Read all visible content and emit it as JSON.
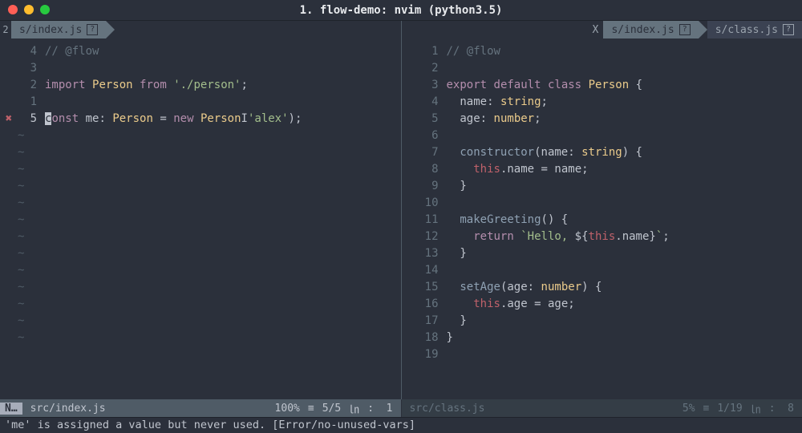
{
  "window": {
    "title": "1. flow-demo: nvim (python3.5)"
  },
  "left": {
    "tab": {
      "prefix": "2",
      "label": "s/index.js",
      "badge": "?"
    },
    "lines": [
      {
        "n": "4",
        "sign": "",
        "html": "<span class='c-comment'>// @flow</span>"
      },
      {
        "n": "3",
        "sign": "",
        "html": ""
      },
      {
        "n": "2",
        "sign": "",
        "html": "<span class='c-kw'>import</span> <span class='c-type'>Person</span> <span class='c-kw'>from</span> <span class='c-str'>'./person'</span><span class='c-punc'>;</span>"
      },
      {
        "n": "1",
        "sign": "",
        "html": ""
      },
      {
        "n": "5",
        "sign": "✖",
        "cur": true,
        "html": "<span class='cursor'>c</span><span class='c-kw'>onst</span> <span class='c-ident'>me</span><span class='c-punc'>:</span> <span class='c-type'>Person</span> <span class='c-punc'>=</span> <span class='c-kw'>new</span> <span class='c-type'>Person</span><span class='caret'>I</span><span class='c-punc'></span><span class='c-str'>'alex'</span><span class='c-punc'>);</span>"
      }
    ],
    "tildes": 13,
    "status": {
      "mode": "N…",
      "file": "src/index.js",
      "percent": "100%",
      "hamburger": "≡",
      "pos": "5/5",
      "ln_mark": "㏑",
      "col_sep": ":",
      "col": "1"
    }
  },
  "right": {
    "tabs": [
      {
        "x": "X",
        "label": "s/index.js",
        "badge": "?",
        "active": true
      },
      {
        "label": "s/class.js",
        "badge": "?",
        "active": false
      }
    ],
    "lines": [
      {
        "n": "1",
        "html": "<span class='c-comment'>// @flow</span>"
      },
      {
        "n": "2",
        "html": ""
      },
      {
        "n": "3",
        "html": "<span class='c-kw'>export</span> <span class='c-kw'>default</span> <span class='c-kw'>class</span> <span class='c-type'>Person</span> <span class='c-punc'>{</span>"
      },
      {
        "n": "4",
        "html": "  <span class='c-ident'>name</span><span class='c-punc'>:</span> <span class='c-type'>string</span><span class='c-punc'>;</span>"
      },
      {
        "n": "5",
        "html": "  <span class='c-ident'>age</span><span class='c-punc'>:</span> <span class='c-type'>number</span><span class='c-punc'>;</span>"
      },
      {
        "n": "6",
        "html": ""
      },
      {
        "n": "7",
        "html": "  <span class='c-func'>constructor</span><span class='c-punc'>(</span><span class='c-ident'>name</span><span class='c-punc'>:</span> <span class='c-type'>string</span><span class='c-punc'>) {</span>"
      },
      {
        "n": "8",
        "html": "    <span class='c-this'>this</span><span class='c-punc'>.</span><span class='c-ident'>name</span> <span class='c-punc'>=</span> <span class='c-ident'>name</span><span class='c-punc'>;</span>"
      },
      {
        "n": "9",
        "html": "  <span class='c-punc'>}</span>"
      },
      {
        "n": "10",
        "html": ""
      },
      {
        "n": "11",
        "html": "  <span class='c-func'>makeGreeting</span><span class='c-punc'>() {</span>"
      },
      {
        "n": "12",
        "html": "    <span class='c-kw'>return</span> <span class='c-str'>`Hello, </span><span class='c-punc'>${</span><span class='c-this'>this</span><span class='c-punc'>.</span><span class='c-ident'>name</span><span class='c-punc'>}</span><span class='c-str'>`</span><span class='c-punc'>;</span>"
      },
      {
        "n": "13",
        "html": "  <span class='c-punc'>}</span>"
      },
      {
        "n": "14",
        "html": ""
      },
      {
        "n": "15",
        "html": "  <span class='c-func'>setAge</span><span class='c-punc'>(</span><span class='c-ident'>age</span><span class='c-punc'>:</span> <span class='c-type'>number</span><span class='c-punc'>) {</span>"
      },
      {
        "n": "16",
        "html": "    <span class='c-this'>this</span><span class='c-punc'>.</span><span class='c-ident'>age</span> <span class='c-punc'>=</span> <span class='c-ident'>age</span><span class='c-punc'>;</span>"
      },
      {
        "n": "17",
        "html": "  <span class='c-punc'>}</span>"
      },
      {
        "n": "18",
        "html": "<span class='c-punc'>}</span>"
      },
      {
        "n": "19",
        "html": ""
      }
    ],
    "status": {
      "file": "src/class.js",
      "percent": "5%",
      "hamburger": "≡",
      "pos": "1/19",
      "ln_mark": "㏑",
      "col_sep": ":",
      "col": "8"
    }
  },
  "cmdline": "'me' is assigned a value but never used. [Error/no-unused-vars]"
}
